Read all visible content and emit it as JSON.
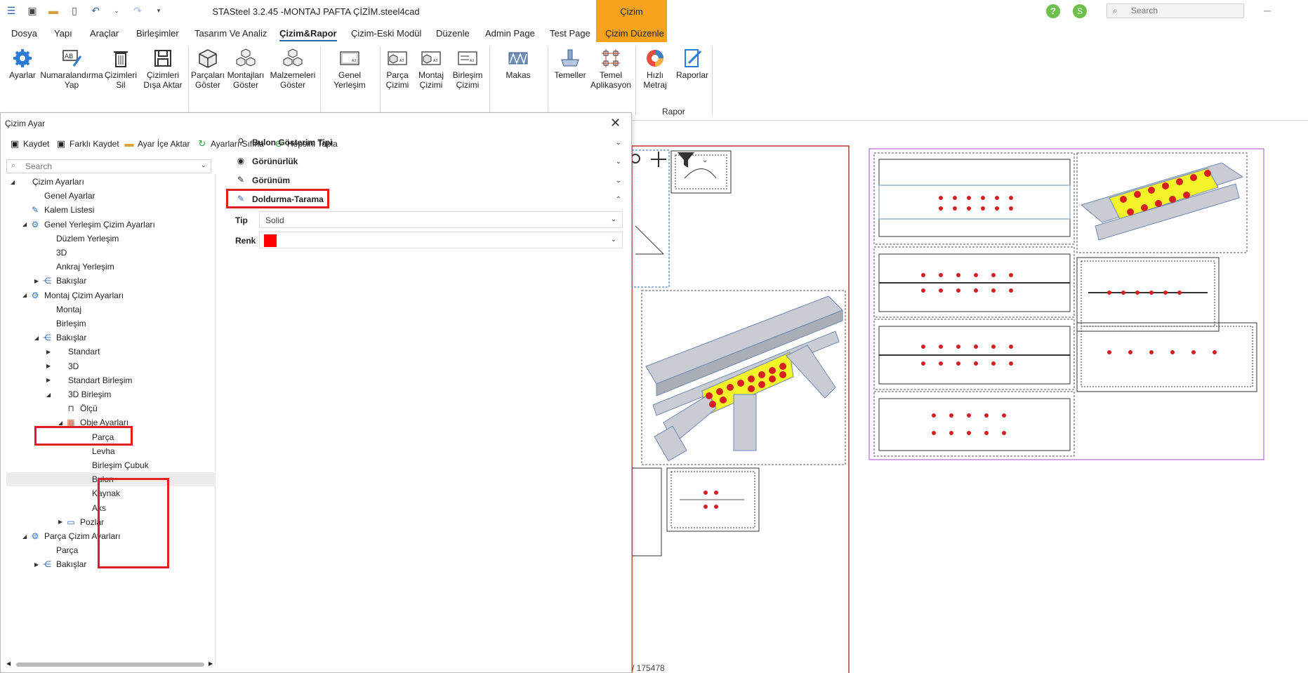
{
  "app": {
    "title": "STASteel 3.2.45 -MONTAJ PAFTA ÇİZİM.steel4cad",
    "context_tab_title": "Çizim",
    "help_label": "?",
    "user_initial": "S"
  },
  "search": {
    "placeholder": "Search"
  },
  "menu": [
    "Dosya",
    "Yapı",
    "Araçlar",
    "Birleşimler",
    "Tasarım Ve Analiz",
    "Çizim&Rapor",
    "Çizim-Eski Modül",
    "Düzenle",
    "Admin Page",
    "Test Page",
    "Çizim Düzenle"
  ],
  "ribbon": {
    "buttons": [
      {
        "label": "Ayarlar",
        "icon": "gear-icon"
      },
      {
        "label": "Numaralandırma Yap",
        "icon": "numbering-icon"
      },
      {
        "label": "Çizimleri Sil",
        "icon": "trash-icon"
      },
      {
        "label": "Çizimleri Dışa Aktar",
        "icon": "save-export-icon"
      },
      {
        "label": "Parçaları Göster",
        "icon": "cube-icon"
      },
      {
        "label": "Montajları Göster",
        "icon": "cubes-icon"
      },
      {
        "label": "Malzemeleri Göster",
        "icon": "cubes-icon"
      },
      {
        "label": "Genel Yerleşim",
        "icon": "sheet-icon"
      },
      {
        "label": "Parça Çizimi",
        "icon": "sheet-icon"
      },
      {
        "label": "Montaj Çizimi",
        "icon": "sheet-icon"
      },
      {
        "label": "Birleşim Çizimi",
        "icon": "sheet-icon"
      },
      {
        "label": "Makas",
        "icon": "truss-icon"
      },
      {
        "label": "Temeller",
        "icon": "foundation-icon"
      },
      {
        "label": "Temel Aplikasyon",
        "icon": "grid-icon"
      },
      {
        "label": "Hızlı Metraj",
        "icon": "chart-icon"
      },
      {
        "label": "Raporlar",
        "icon": "report-icon"
      }
    ],
    "group_rapor": "Rapor"
  },
  "dialog": {
    "title": "Çizim Ayar",
    "toolbar": [
      "Kaydet",
      "Farklı Kaydet",
      "Ayar İçe Aktar",
      "Ayarları Sıfırla",
      "Hepsini Topla"
    ],
    "tree_search_placeholder": "Search",
    "tree": [
      {
        "label": "Çizim Ayarları",
        "level": 0,
        "expanded": true
      },
      {
        "label": "Genel Ayarlar",
        "level": 1
      },
      {
        "label": "Kalem Listesi",
        "level": 1
      },
      {
        "label": "Genel Yerleşim Çizim Ayarları",
        "level": 1,
        "expanded": true
      },
      {
        "label": "Düzlem Yerleşim",
        "level": 2
      },
      {
        "label": "3D",
        "level": 2
      },
      {
        "label": "Ankraj Yerleşim",
        "level": 2
      },
      {
        "label": "Bakışlar",
        "level": 2,
        "expanded": false
      },
      {
        "label": "Montaj Çizim Ayarları",
        "level": 1,
        "expanded": true
      },
      {
        "label": "Montaj",
        "level": 2
      },
      {
        "label": "Birleşim",
        "level": 2
      },
      {
        "label": "Bakışlar",
        "level": 2,
        "expanded": true
      },
      {
        "label": "Standart",
        "level": 3,
        "expanded": false
      },
      {
        "label": "3D",
        "level": 3,
        "expanded": false
      },
      {
        "label": "Standart Birleşim",
        "level": 3,
        "expanded": false
      },
      {
        "label": "3D Birleşim",
        "level": 3,
        "expanded": true
      },
      {
        "label": "Ölçü",
        "level": 4
      },
      {
        "label": "Obje Ayarları",
        "level": 4,
        "expanded": true
      },
      {
        "label": "Parça",
        "level": 5
      },
      {
        "label": "Levha",
        "level": 5
      },
      {
        "label": "Birleşim Çubuk",
        "level": 5
      },
      {
        "label": "Bulon",
        "level": 5,
        "selected": true
      },
      {
        "label": "Kaynak",
        "level": 5
      },
      {
        "label": "Aks",
        "level": 5
      },
      {
        "label": "Pozlar",
        "level": 4,
        "expanded": false
      },
      {
        "label": "Parça Çizim Ayarları",
        "level": 1,
        "expanded": true
      },
      {
        "label": "Parça",
        "level": 2
      },
      {
        "label": "Bakışlar",
        "level": 2,
        "expanded": false
      }
    ],
    "sections": [
      {
        "label": "Bulon Gösterim Tipi",
        "expanded": false
      },
      {
        "label": "Görünürlük",
        "expanded": false
      },
      {
        "label": "Görünüm",
        "expanded": false
      },
      {
        "label": "Doldurma-Tarama",
        "expanded": true
      }
    ],
    "props": {
      "tip_label": "Tip",
      "tip_value": "Solid",
      "renk_label": "Renk",
      "renk_color": "#ff0000"
    }
  },
  "canvas": {
    "footer_text": "/ 175478"
  },
  "colors": {
    "accent": "#2b64b1",
    "context_tab": "#f7a21b",
    "highlight": "#e02020"
  }
}
